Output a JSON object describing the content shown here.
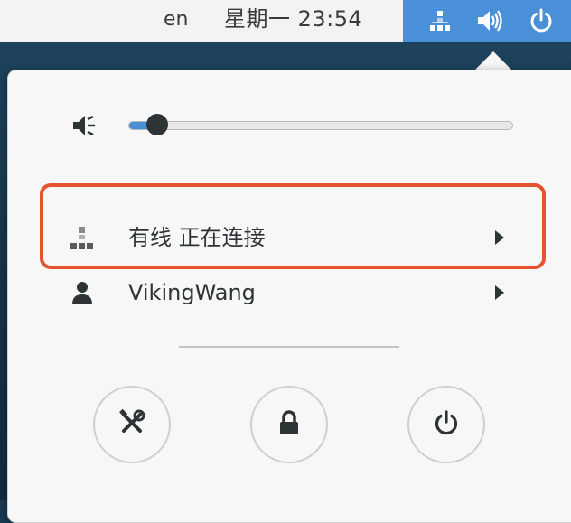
{
  "topbar": {
    "language": "en",
    "clock": "星期一 23:54",
    "icons": [
      "network-wired-icon",
      "audio-volume-icon",
      "power-icon"
    ],
    "accent": "#4a90d9"
  },
  "volume": {
    "icon": "audio-volume-low-icon",
    "level": 0.07
  },
  "network": {
    "icon": "network-wired-icon",
    "label": "有线 正在连接"
  },
  "user": {
    "icon": "user-icon",
    "label": "VikingWang"
  },
  "actions": [
    {
      "name": "settings",
      "icon": "settings-tools-icon"
    },
    {
      "name": "lock",
      "icon": "lock-icon"
    },
    {
      "name": "power-off",
      "icon": "power-icon"
    }
  ],
  "highlight_color": "#e5532f"
}
